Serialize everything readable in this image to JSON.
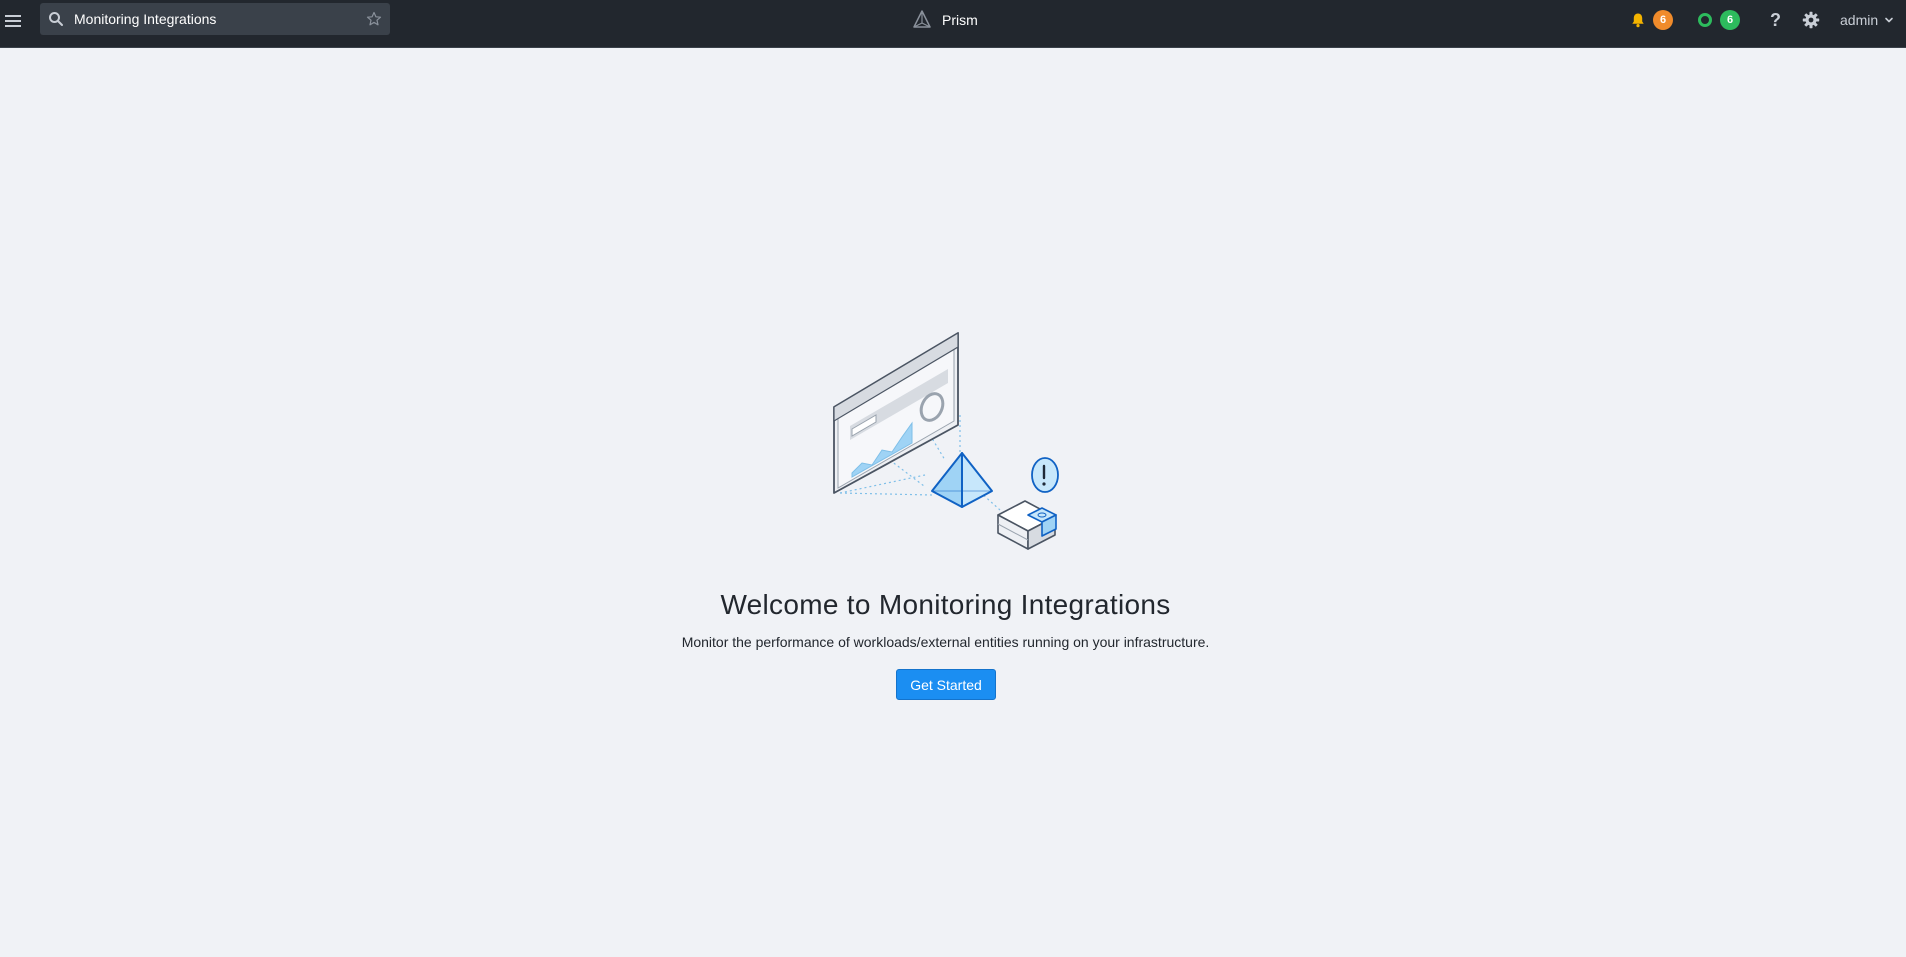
{
  "header": {
    "search": {
      "value": "Monitoring Integrations",
      "placeholder": "Search"
    },
    "brand_name": "Prism",
    "alerts_count": "6",
    "tasks_count": "6",
    "help_label": "?",
    "user_name": "admin"
  },
  "main": {
    "title": "Welcome to Monitoring Integrations",
    "subtitle": "Monitor the performance of workloads/external entities running on your infrastructure.",
    "cta_label": "Get Started"
  },
  "icons": {
    "menu": "hamburger-menu-icon",
    "search": "search-icon",
    "favorite": "star-icon",
    "logo": "prism-logo-icon",
    "alerts": "bell-icon",
    "tasks": "circle-status-icon",
    "help": "help-icon",
    "settings": "gear-icon",
    "user_menu": "chevron-down-icon"
  },
  "colors": {
    "topbar": "#22272e",
    "page_background": "#f0f2f6",
    "primary_button": "#1b8ef2",
    "alert_badge": "#f08b2b",
    "task_badge": "#2dbb5d",
    "bell": "#f5b400"
  }
}
